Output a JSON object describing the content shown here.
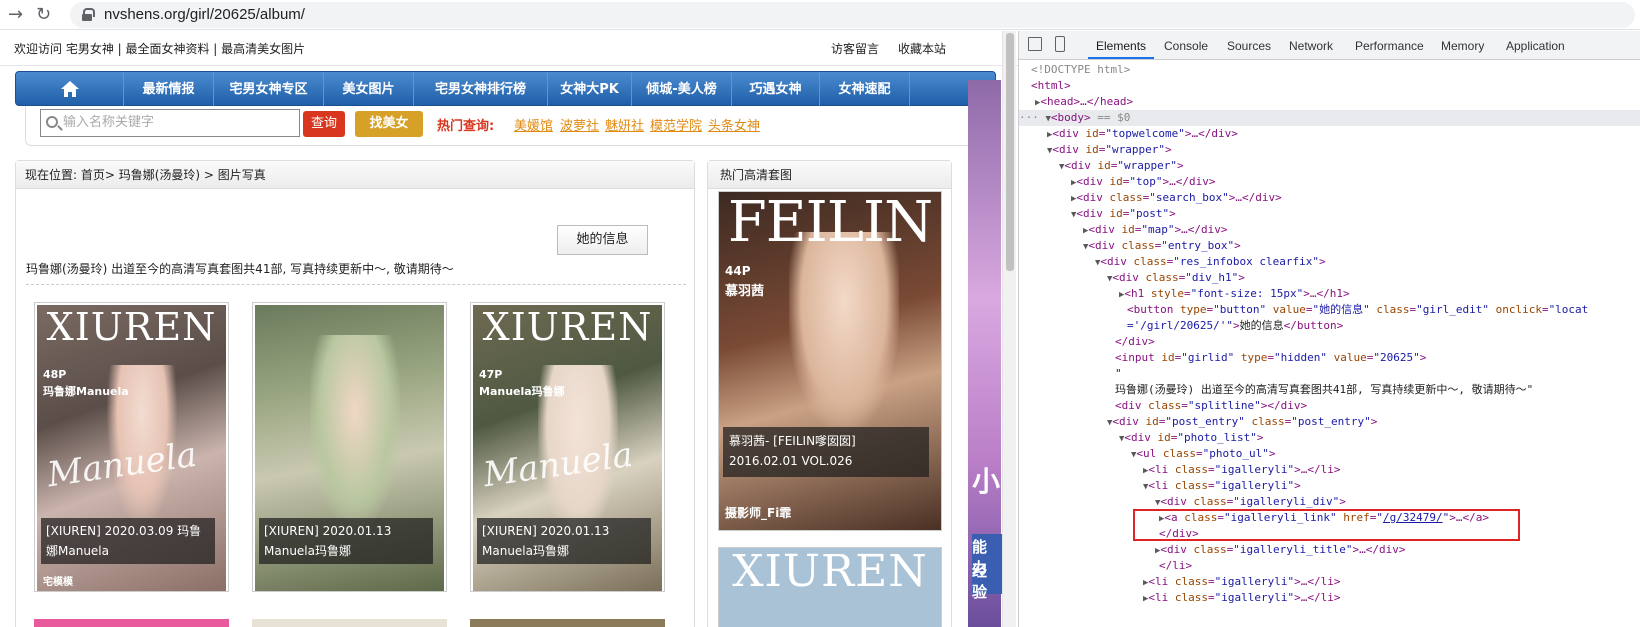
{
  "browser": {
    "url": "nvshens.org/girl/20625/album/"
  },
  "topwelcome": {
    "greeting": "欢迎访问 宅男女神 | 最全面女神资料 | 最高清美女图片",
    "guestbook": "访客留言",
    "favorite": "收藏本站"
  },
  "nav": {
    "items": [
      "最新情报",
      "宅男女神专区",
      "美女图片",
      "宅男女神排行榜",
      "女神大PK",
      "倾城-美人榜",
      "巧遇女神",
      "女神速配"
    ]
  },
  "search": {
    "placeholder": "输入名称关键字",
    "query_button": "查询",
    "find_button": "找美女",
    "hot_label": "热门查询:",
    "hot_links": [
      "美媛馆",
      "波萝社",
      "魅妍社",
      "模范学院",
      "头条女神"
    ]
  },
  "breadcrumb": "现在位置: 首页> 玛鲁娜(汤曼玲) > 图片写真",
  "profile": {
    "info_button": "她的信息",
    "description": "玛鲁娜(汤曼玲) 出道至今的高清写真套图共41部, 写真持续更新中～, 敬请期待～"
  },
  "albums": [
    {
      "brand": "XIUREN",
      "pages": "48P",
      "model": "玛鲁娜Manuela",
      "signature": "Manuela",
      "caption": "[XIUREN] 2020.03.09 玛鲁娜Manuela",
      "bottom": "宅模模"
    },
    {
      "brand": "",
      "pages": "",
      "model": "",
      "signature": "",
      "caption": "[XIUREN] 2020.01.13 Manuela玛鲁娜",
      "bottom": ""
    },
    {
      "brand": "XIUREN",
      "pages": "47P",
      "model": "Manuela玛鲁娜",
      "signature": "Manuela",
      "caption": "[XIUREN] 2020.01.13 Manuela玛鲁娜",
      "bottom": ""
    }
  ],
  "right_panel": {
    "title": "热门高清套图",
    "feilin_brand": "FEILIN",
    "feilin_pages": "44P",
    "feilin_model": "慕羽茜",
    "feilin_caption": "慕羽茜- [FEILIN嗲囡囡] 2016.02.01 VOL.026",
    "feilin_photographer": "摄影师_Fi霏",
    "second_brand": "XIUREN"
  },
  "side_strip": {
    "text1": "小",
    "text2": "能力",
    "text3": "经验"
  },
  "devtools": {
    "tabs": [
      "Elements",
      "Console",
      "Sources",
      "Network",
      "Performance",
      "Memory",
      "Application"
    ]
  }
}
